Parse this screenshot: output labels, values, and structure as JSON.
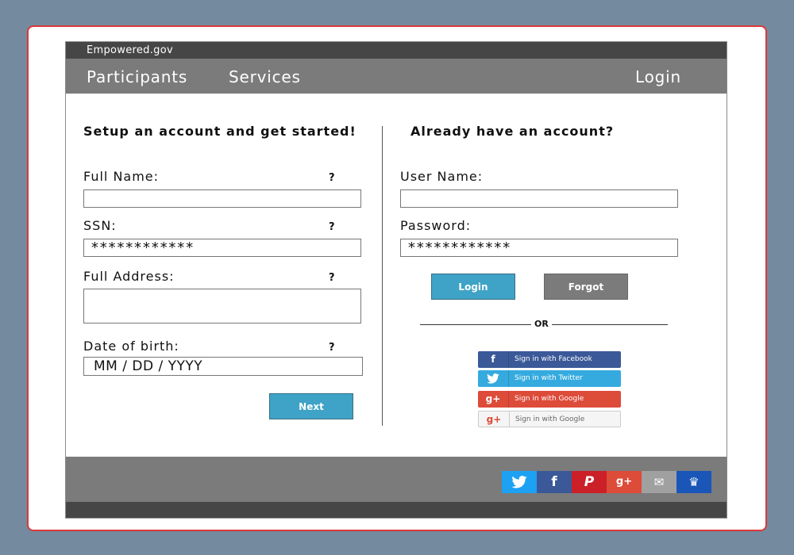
{
  "site": {
    "domain": "Empowered.gov"
  },
  "nav": {
    "participants": "Participants",
    "services": "Services",
    "login": "Login"
  },
  "signup": {
    "heading": "Setup an account and get started!",
    "fields": {
      "full_name": {
        "label": "Full Name:",
        "value": ""
      },
      "ssn": {
        "label": "SSN:",
        "value": "************"
      },
      "address": {
        "label": "Full Address:",
        "value": ""
      },
      "dob": {
        "label": "Date of birth:",
        "value": "MM / DD / YYYY"
      }
    },
    "help": "?",
    "next_label": "Next"
  },
  "signin": {
    "heading": "Already have an account?",
    "username": {
      "label": "User Name:",
      "value": ""
    },
    "password": {
      "label": "Password:",
      "value": "************"
    },
    "login_label": "Login",
    "forgot_label": "Forgot",
    "or_label": "OR",
    "social": {
      "facebook": {
        "icon": "f",
        "label": "Sign in with Facebook",
        "color": "#3b5998"
      },
      "twitter": {
        "icon": "twitter-bird",
        "label": "Sign in with Twitter",
        "color": "#35aadf"
      },
      "google_red": {
        "icon": "g+",
        "label": "Sign in with Google",
        "color": "#dd4b39"
      },
      "google_light": {
        "icon": "g+",
        "label": "Sign in with Google",
        "color": "#f5f5f5"
      }
    }
  },
  "footer": {
    "share": [
      {
        "name": "twitter",
        "glyph": "🐦",
        "color": "#1da1f2"
      },
      {
        "name": "facebook",
        "glyph": "f",
        "color": "#3b5998"
      },
      {
        "name": "pinterest",
        "glyph": "℘",
        "color": "#cb2027"
      },
      {
        "name": "google-plus",
        "glyph": "g+",
        "color": "#dd4b39"
      },
      {
        "name": "email",
        "glyph": "✉",
        "color": "#a0a0a0"
      },
      {
        "name": "crown",
        "glyph": "♛",
        "color": "#1a56b8"
      }
    ]
  }
}
